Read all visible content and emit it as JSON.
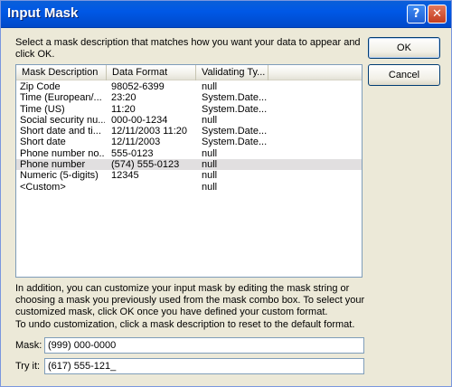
{
  "window": {
    "title": "Input Mask",
    "help_glyph": "?",
    "close_glyph": "✕"
  },
  "instruction": "Select a mask description that matches how you want your data to appear and click OK.",
  "buttons": {
    "ok": "OK",
    "cancel": "Cancel"
  },
  "list": {
    "columns": [
      "Mask Description",
      "Data Format",
      "Validating Ty...",
      ""
    ],
    "rows": [
      {
        "description": "Zip Code",
        "format": "98052-6399",
        "type": "null"
      },
      {
        "description": "Time (European/...",
        "format": "23:20",
        "type": "System.Date..."
      },
      {
        "description": "Time (US)",
        "format": "11:20",
        "type": "System.Date..."
      },
      {
        "description": "Social security nu...",
        "format": "000-00-1234",
        "type": "null"
      },
      {
        "description": "Short date and ti...",
        "format": "12/11/2003 11:20",
        "type": "System.Date..."
      },
      {
        "description": "Short date",
        "format": "12/11/2003",
        "type": "System.Date..."
      },
      {
        "description": "Phone number no...",
        "format": "555-0123",
        "type": "null"
      },
      {
        "description": "Phone number",
        "format": "(574) 555-0123",
        "type": "null"
      },
      {
        "description": "Numeric (5-digits)",
        "format": "12345",
        "type": "null"
      },
      {
        "description": "<Custom>",
        "format": "",
        "type": "null"
      }
    ],
    "selected_index": 7
  },
  "paragraph1": "In addition, you can customize your input mask by editing the mask string or choosing a mask you previously used from the mask combo box.  To select your customized mask, click OK once you have defined your custom format.",
  "paragraph2": "To undo customization, click a mask description to reset to the default format.",
  "mask": {
    "label": "Mask:",
    "value": "(999) 000-0000"
  },
  "try_it": {
    "label": "Try it:",
    "value": "(617) 555-121_"
  }
}
